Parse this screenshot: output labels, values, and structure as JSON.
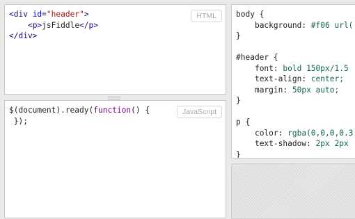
{
  "panels": {
    "html": {
      "label": "HTML",
      "lines": [
        [
          {
            "t": "<div ",
            "c": "tag"
          },
          {
            "t": "id",
            "c": "attr"
          },
          {
            "t": "=",
            "c": "tag"
          },
          {
            "t": "\"header\"",
            "c": "str"
          },
          {
            "t": ">",
            "c": "tag"
          }
        ],
        [
          {
            "t": "    "
          },
          {
            "t": "<p>",
            "c": "tag"
          },
          {
            "t": "jsFiddle"
          },
          {
            "t": "</p>",
            "c": "tag"
          }
        ],
        [
          {
            "t": "</div>",
            "c": "tag"
          }
        ]
      ]
    },
    "javascript": {
      "label": "JavaScript",
      "lines": [
        [
          {
            "t": "$(document).ready("
          },
          {
            "t": "function",
            "c": "kw"
          },
          {
            "t": "() {"
          }
        ],
        [
          {
            "t": " });"
          }
        ]
      ]
    },
    "css": {
      "lines": [
        [
          {
            "t": "body {"
          }
        ],
        [
          {
            "t": "    "
          },
          {
            "t": "background",
            "c": "prop"
          },
          {
            "t": ": "
          },
          {
            "t": "#f06 url(",
            "c": "val"
          }
        ],
        [
          {
            "t": "}"
          }
        ],
        [
          {
            "t": ""
          }
        ],
        [
          {
            "t": "#header {"
          }
        ],
        [
          {
            "t": "    "
          },
          {
            "t": "font",
            "c": "prop"
          },
          {
            "t": ": "
          },
          {
            "t": "bold 150px/1.5",
            "c": "val"
          }
        ],
        [
          {
            "t": "    "
          },
          {
            "t": "text-align",
            "c": "prop"
          },
          {
            "t": ": "
          },
          {
            "t": "center;",
            "c": "val"
          }
        ],
        [
          {
            "t": "    "
          },
          {
            "t": "margin",
            "c": "prop"
          },
          {
            "t": ": "
          },
          {
            "t": "50px auto;",
            "c": "val"
          }
        ],
        [
          {
            "t": "}"
          }
        ],
        [
          {
            "t": ""
          }
        ],
        [
          {
            "t": "p {"
          }
        ],
        [
          {
            "t": "    "
          },
          {
            "t": "color",
            "c": "prop"
          },
          {
            "t": ": "
          },
          {
            "t": "rgba(0,0,0,0.3",
            "c": "val"
          }
        ],
        [
          {
            "t": "    "
          },
          {
            "t": "text-shadow",
            "c": "prop"
          },
          {
            "t": ": "
          },
          {
            "t": "2px 2px",
            "c": "val"
          }
        ],
        [
          {
            "t": "}"
          }
        ]
      ]
    }
  }
}
